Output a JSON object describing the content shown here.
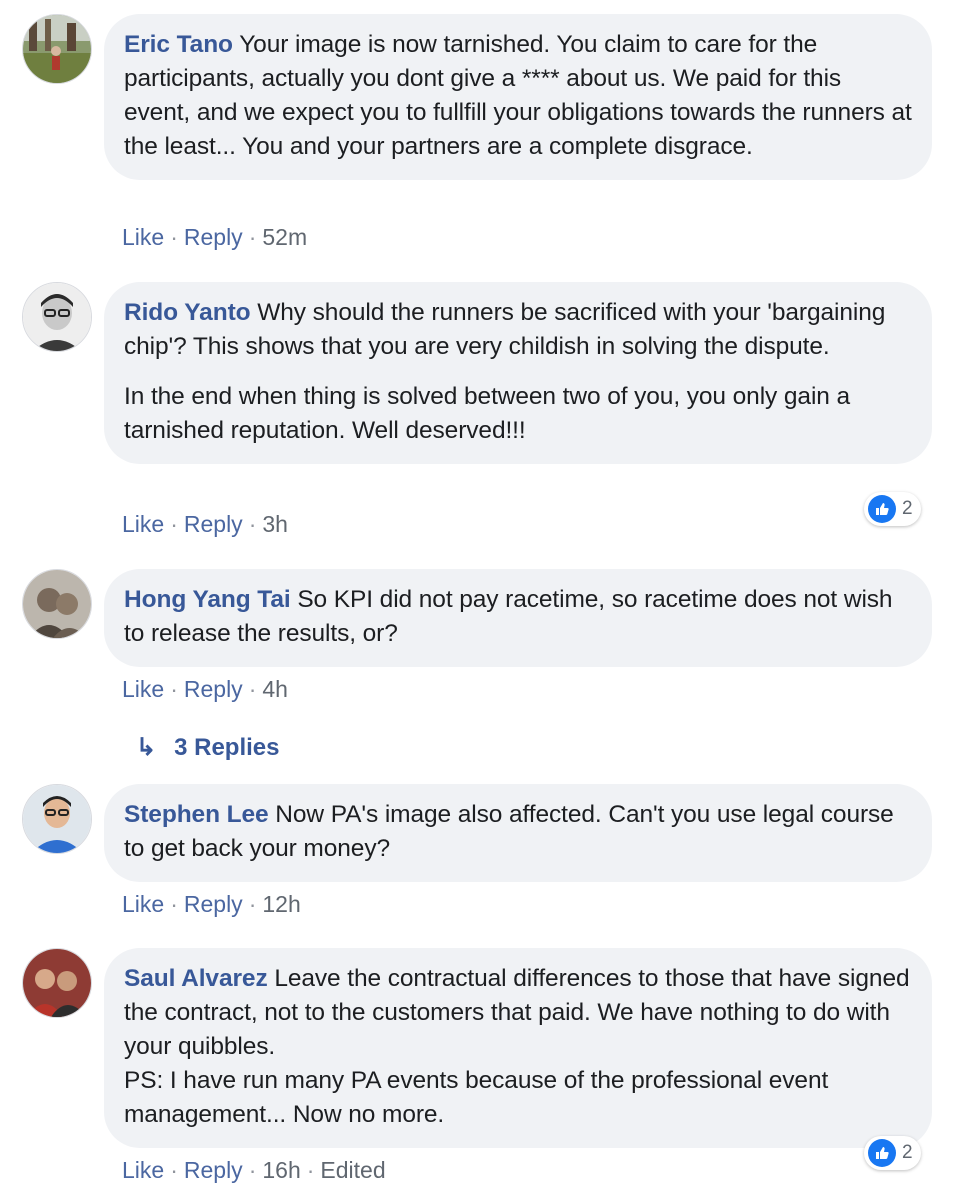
{
  "comments": [
    {
      "author": "Eric Tano",
      "paragraphs": [
        "Your image is now tarnished. You claim to care for the participants, actually you dont give a **** about us. We paid for this event, and we expect you to fullfill your obligations towards the runners at the least... You and your partners are a complete disgrace."
      ],
      "like_label": "Like",
      "reply_label": "Reply",
      "time": "52m"
    },
    {
      "author": "Rido Yanto",
      "paragraphs": [
        "Why should the runners be sacrificed with your 'bargaining chip'? This shows that you are very childish in solving the dispute.",
        "In the end when thing is solved between two of you, you only gain a tarnished reputation. Well deserved!!!"
      ],
      "like_label": "Like",
      "reply_label": "Reply",
      "time": "3h",
      "reaction_count": "2"
    },
    {
      "author": "Hong Yang Tai",
      "paragraphs": [
        "So KPI did not pay racetime, so racetime does not wish to release the results, or?"
      ],
      "like_label": "Like",
      "reply_label": "Reply",
      "time": "4h",
      "replies_label": "3 Replies"
    },
    {
      "author": "Stephen Lee",
      "paragraphs": [
        "Now PA's image also affected. Can't you use legal course to get back your money?"
      ],
      "like_label": "Like",
      "reply_label": "Reply",
      "time": "12h"
    },
    {
      "author": "Saul Alvarez",
      "paragraphs": [
        "Leave the contractual differences to those that have signed the contract, not to the customers that paid. We have nothing to do with your quibbles.",
        "PS: I have run many PA events because of the professional event management... Now no more."
      ],
      "like_label": "Like",
      "reply_label": "Reply",
      "time": "16h",
      "edited": "Edited",
      "reaction_count": "2"
    }
  ],
  "colors": {
    "author": "#385898",
    "bubble": "#f0f2f5",
    "action_link": "#4b67a1",
    "like_blue": "#1877f2"
  }
}
